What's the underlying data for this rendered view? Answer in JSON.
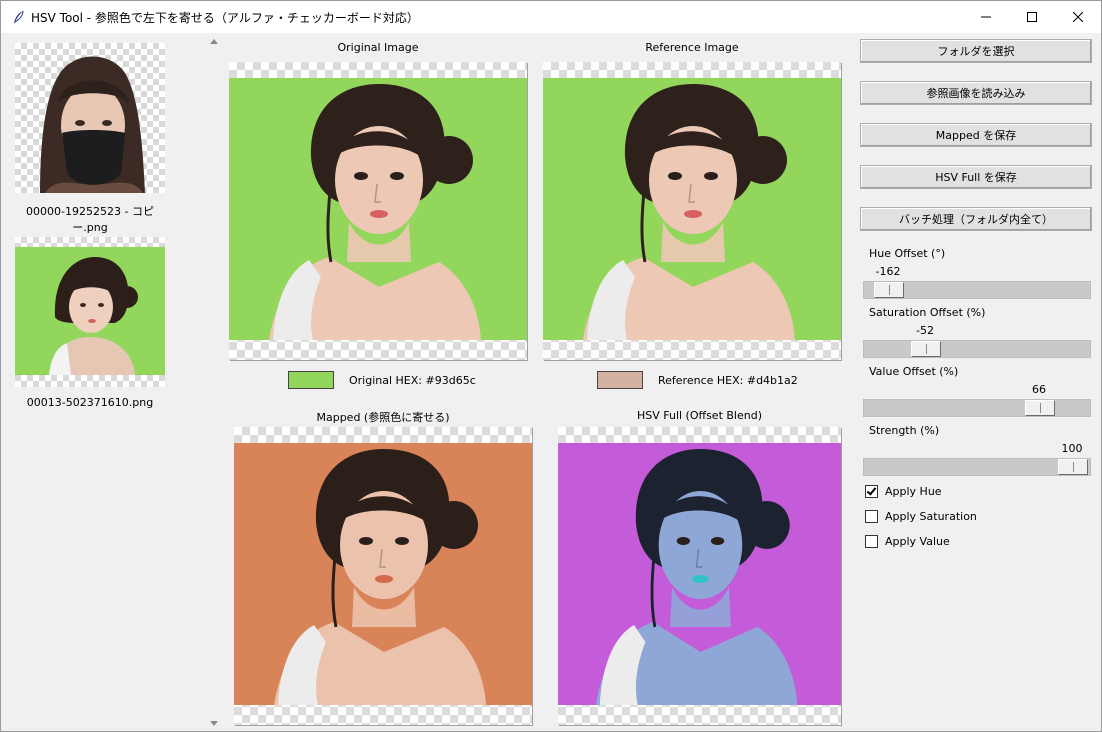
{
  "window": {
    "title": "HSV Tool - 参照色で左下を寄せる（アルファ・チェッカーボード対応）",
    "icons": [
      "feather-icon",
      "minimize-icon",
      "maximize-icon",
      "close-icon"
    ]
  },
  "sidebar": {
    "files": [
      {
        "label": "00000-19252523 - コピー.png",
        "kind": "masked-portrait"
      },
      {
        "label": "00013-502371610.png",
        "kind": "green-portrait"
      }
    ]
  },
  "panels": {
    "original": {
      "title": "Original Image",
      "bg": "#93d65c"
    },
    "reference": {
      "title": "Reference Image",
      "bg": "#93d65c"
    },
    "mapped": {
      "title": "Mapped (参照色に寄せる)",
      "bg": "#d98358"
    },
    "hsvfull": {
      "title": "HSV Full (Offset Blend)",
      "bg": "#c45bd9"
    }
  },
  "hex": {
    "original": {
      "label": "Original HEX: #93d65c",
      "color": "#93d65c"
    },
    "reference": {
      "label": "Reference HEX: #d4b1a2",
      "color": "#d4b1a2"
    }
  },
  "controls": {
    "buttons": [
      "フォルダを選択",
      "参照画像を読み込み",
      "Mapped を保存",
      "HSV Full を保存",
      "バッチ処理（フォルダ内全て）"
    ],
    "sliders": [
      {
        "label": "Hue Offset (°)",
        "value": "-162",
        "min": -180,
        "max": 180,
        "level": -162
      },
      {
        "label": "Saturation Offset (%)",
        "value": "-52",
        "min": -100,
        "max": 100,
        "level": -52
      },
      {
        "label": "Value Offset (%)",
        "value": "66",
        "min": -100,
        "max": 100,
        "level": 66
      },
      {
        "label": "Strength (%)",
        "value": "100",
        "min": 0,
        "max": 100,
        "level": 100
      }
    ],
    "checkboxes": [
      {
        "label": "Apply Hue",
        "checked": true
      },
      {
        "label": "Apply Saturation",
        "checked": false
      },
      {
        "label": "Apply Value",
        "checked": false
      }
    ]
  }
}
